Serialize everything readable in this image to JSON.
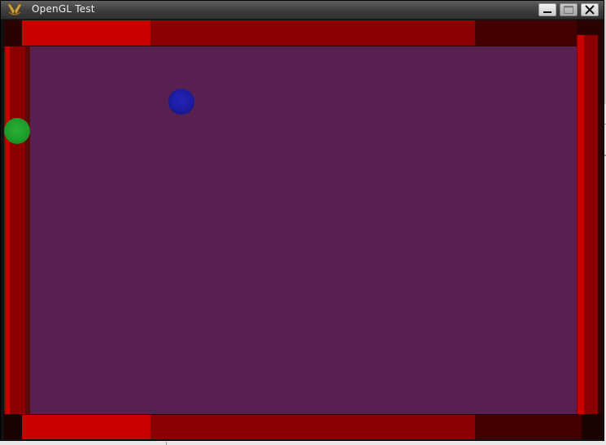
{
  "window": {
    "title": "OpenGL Test",
    "icon": "app-logo-icon",
    "controls": {
      "minimize_icon": "minimize-icon",
      "maximize_icon": "maximize-icon",
      "close_icon": "close-icon"
    }
  },
  "scene": {
    "background_color": "#582050",
    "wall_colors": {
      "bright": "#c80000",
      "mid": "#8a0000",
      "dark": "#420000",
      "shadow": "#6a0000"
    },
    "balls": [
      {
        "name": "blue-ball",
        "color": "#1c1ca0"
      },
      {
        "name": "green-ball",
        "color": "#1e9a2a"
      }
    ]
  }
}
